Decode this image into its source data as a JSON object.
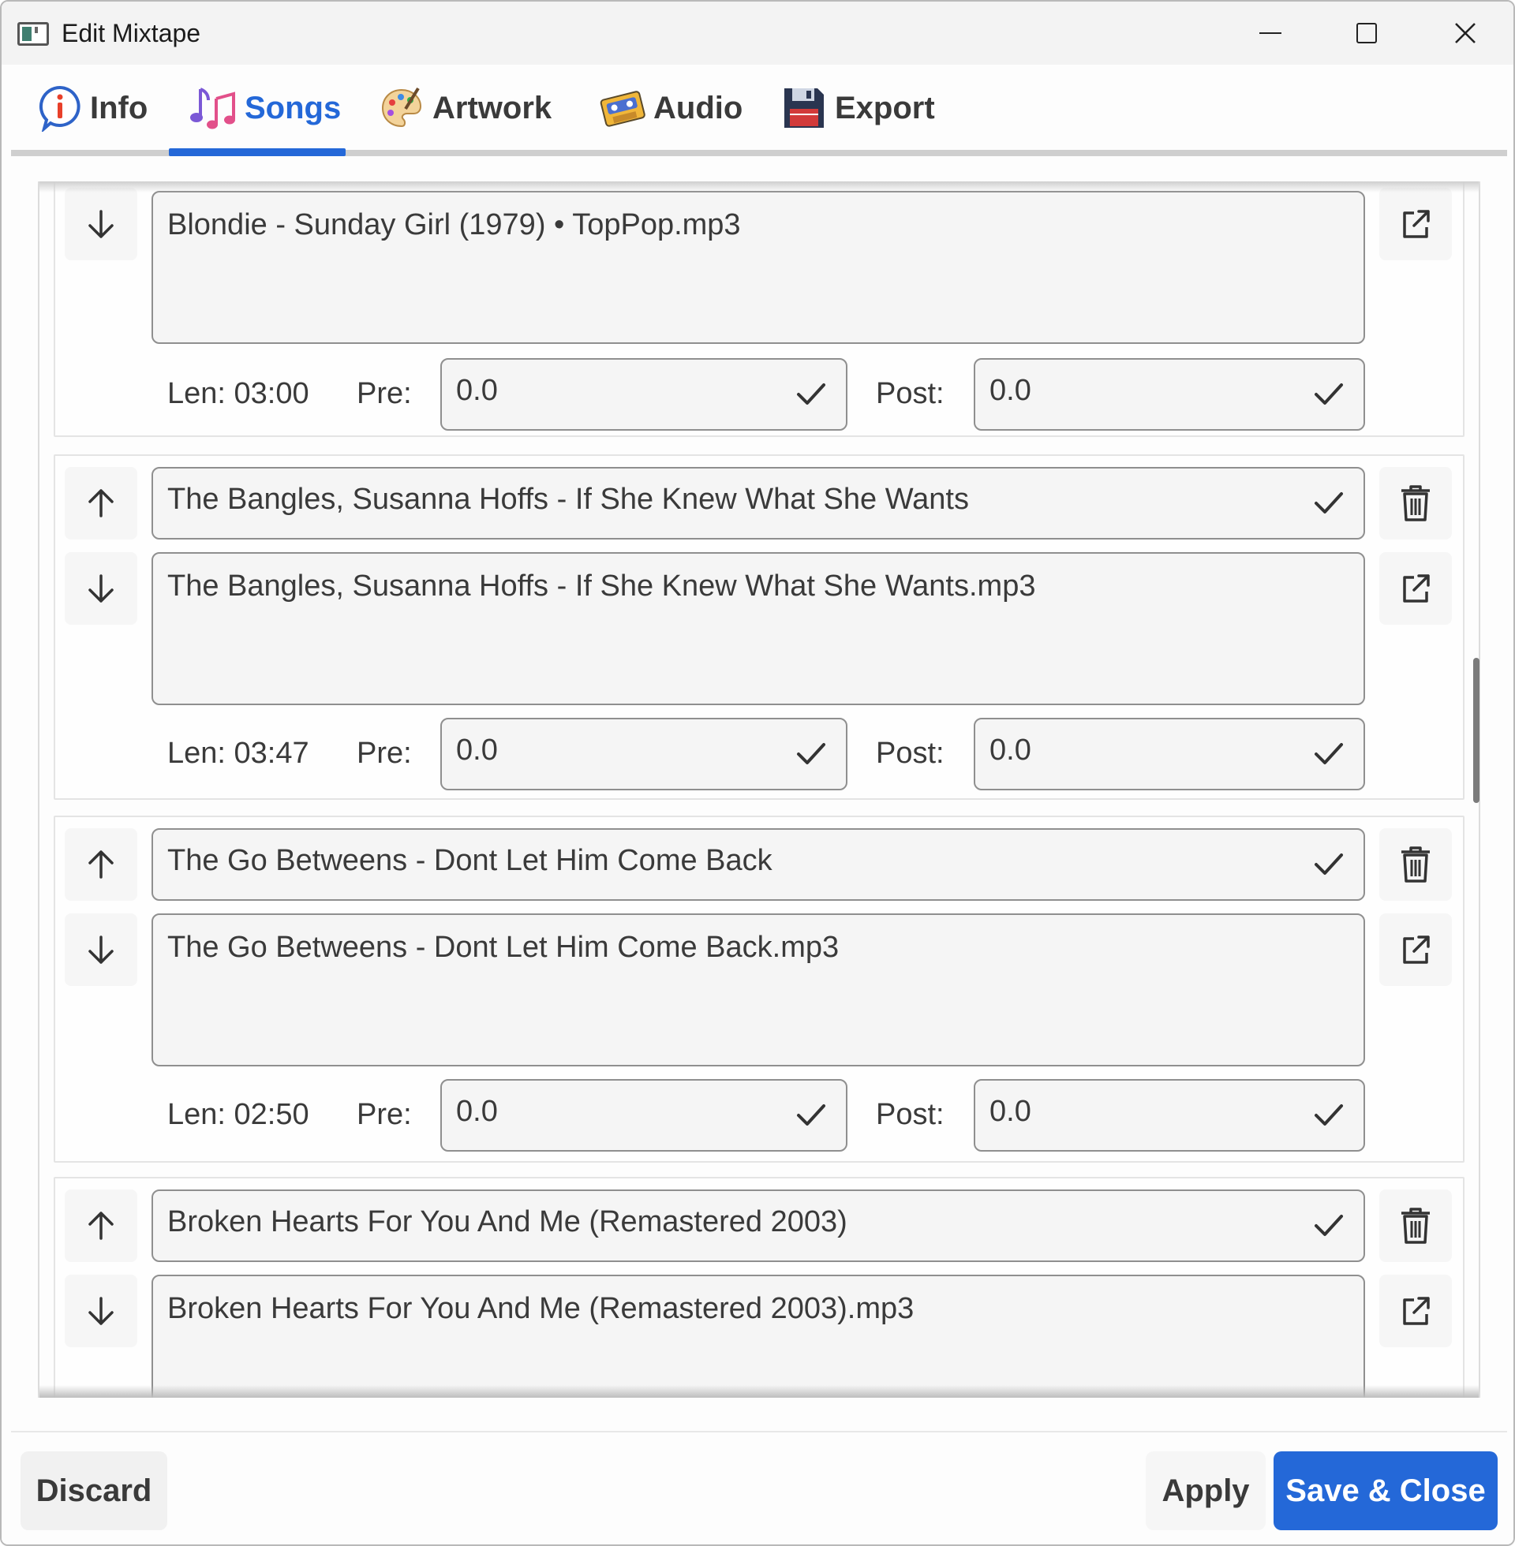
{
  "window": {
    "title": "Edit Mixtape"
  },
  "tabs": [
    {
      "label": "Info",
      "icon": "info-icon"
    },
    {
      "label": "Songs",
      "icon": "music-notes-icon",
      "active": true
    },
    {
      "label": "Artwork",
      "icon": "palette-icon"
    },
    {
      "label": "Audio",
      "icon": "cassette-icon"
    },
    {
      "label": "Export",
      "icon": "floppy-disk-icon"
    }
  ],
  "labels": {
    "pre": "Pre:",
    "post": "Post:"
  },
  "songs": [
    {
      "title": "",
      "filename": "Blondie - Sunday Girl (1979) • TopPop.mp3",
      "length": "Len: 03:00",
      "pre": "0.0",
      "post": "0.0"
    },
    {
      "title": "The Bangles, Susanna Hoffs - If She Knew What She Wants",
      "filename": "The Bangles, Susanna Hoffs - If She Knew What She Wants.mp3",
      "length": "Len: 03:47",
      "pre": "0.0",
      "post": "0.0"
    },
    {
      "title": "The Go Betweens - Dont Let Him Come Back",
      "filename": "The Go Betweens - Dont Let Him Come Back.mp3",
      "length": "Len: 02:50",
      "pre": "0.0",
      "post": "0.0"
    },
    {
      "title": "Broken Hearts For You And Me (Remastered 2003)",
      "filename": "Broken Hearts For You And Me (Remastered 2003).mp3"
    }
  ],
  "footer": {
    "discard": "Discard",
    "apply": "Apply",
    "save_close": "Save & Close"
  },
  "colors": {
    "accent": "#2468d8"
  }
}
